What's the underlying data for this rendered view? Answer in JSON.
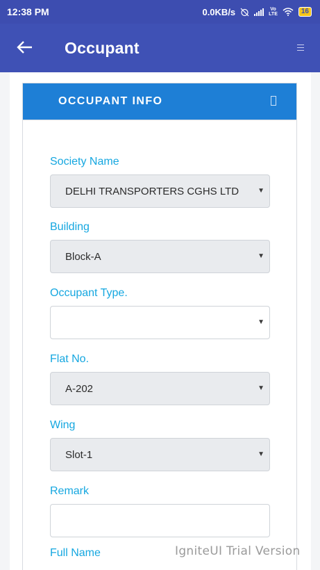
{
  "status_bar": {
    "time": "12:38 PM",
    "network_speed": "0.0KB/s",
    "volte_line1": "Vo",
    "volte_line2": "LTE",
    "battery": "16"
  },
  "app_bar": {
    "title": "Occupant",
    "back_icon": "arrow-left-icon",
    "menu_icon": "menu-icon",
    "color": "#3f51b5"
  },
  "card": {
    "title": "OCCUPANT INFO",
    "header_color": "#1e7fd6"
  },
  "form": {
    "society": {
      "label": "Society Name",
      "value": "DELHI TRANSPORTERS CGHS LTD"
    },
    "building": {
      "label": "Building",
      "value": "Block-A"
    },
    "occupant_type": {
      "label": "Occupant Type.",
      "value": ""
    },
    "flat": {
      "label": "Flat No.",
      "value": "A-202"
    },
    "wing": {
      "label": "Wing",
      "value": "Slot-1"
    },
    "remark": {
      "label": "Remark",
      "value": ""
    },
    "full_name": {
      "label": "Full Name"
    },
    "label_color": "#15a7e0"
  },
  "watermark": "IgniteUI Trial Version"
}
